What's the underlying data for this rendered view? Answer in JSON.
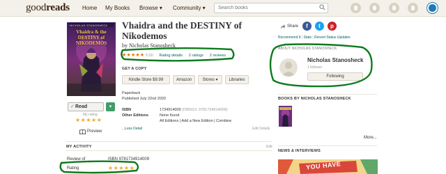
{
  "header": {
    "logo_prefix": "good",
    "logo_suffix": "reads",
    "nav": [
      "Home",
      "My Books",
      "Browse ▾",
      "Community ▾"
    ],
    "search_placeholder": "Search books",
    "icons": [
      "notifications-icon",
      "discussions-icon",
      "messages-icon",
      "friends-icon",
      "profile-avatar-icon"
    ]
  },
  "book": {
    "title": "Vhaidra and the DESTINY of Nikodemos",
    "author": "by Nicholas Stanosheck",
    "rating_stars": "★★★★★",
    "rating_value": "5.00",
    "rating_details": "Rating details",
    "ratings_count": "2 ratings",
    "reviews_count": "2 reviews",
    "cover_title": "Vhaidra & the DESTINY of NIKODEMOS",
    "cover_author": "NICHOLAS STANOSHECK"
  },
  "get_copy": {
    "heading": "GET A COPY",
    "buttons": [
      "Kindle Store $9.99",
      "Amazon",
      "Stores ▾",
      "Libraries"
    ]
  },
  "details": {
    "format": "Paperback",
    "published": "Published July 22nd 2020",
    "isbn_label": "ISBN",
    "isbn_value": "1734914009",
    "isbn13": "(ISBN13: 9781734914009)",
    "other_editions_label": "Other Editions",
    "other_editions_value": "None found",
    "editions_links": "All Editions | Add a New Edition | Combine",
    "less_detail": "...Less Detail",
    "edit_details": "Edit Details"
  },
  "shelf": {
    "status": "Read",
    "check": "✓",
    "dropdown": "▾",
    "my_rating_label": "My rating:",
    "my_rating_stars": "★★★★★",
    "preview": "Preview"
  },
  "activity": {
    "heading": "MY ACTIVITY",
    "edit": "Edit",
    "review_label": "Review of",
    "review_value": "ISBN 9781734914009",
    "rating_label": "Rating",
    "rating_stars": "★★★★★"
  },
  "sidebar": {
    "share": "Share",
    "social": [
      "f",
      "t",
      "p"
    ],
    "links": [
      "Recommend It",
      "Stats",
      "Recent Status Updates"
    ],
    "about_heading": "ABOUT NICHOLAS STANOSHECK",
    "author_name": "Nicholas Stanosheck",
    "followers": "1 follower",
    "follow_button": "Following",
    "books_heading": "BOOKS BY NICHOLAS STANOSHECK",
    "more": "More...",
    "news_heading": "NEWS & INTERVIEWS",
    "news_text": "YOU HAVE"
  },
  "colors": {
    "header_bg": "#f4f1ea",
    "link_teal": "#00635d",
    "star_orange": "#e87400",
    "shelf_green": "#409d69",
    "highlight_green": "#0e7a1e",
    "facebook": "#3b5998",
    "twitter": "#1da1f2",
    "pinterest": "#cb2027"
  }
}
